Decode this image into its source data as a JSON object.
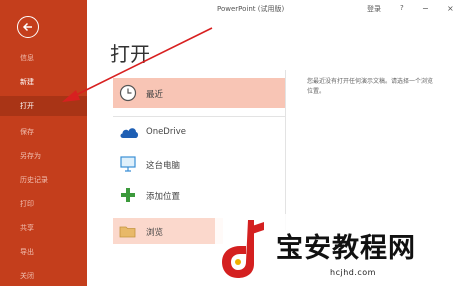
{
  "window": {
    "title": "PowerPoint (试用版)",
    "login": "登录",
    "help": "?",
    "minimize": "−",
    "close": "×"
  },
  "nav": {
    "items": [
      {
        "label": "信息"
      },
      {
        "label": "新建"
      },
      {
        "label": "打开"
      },
      {
        "label": "保存"
      },
      {
        "label": "另存为"
      },
      {
        "label": "历史记录"
      },
      {
        "label": "打印"
      },
      {
        "label": "共享"
      },
      {
        "label": "导出"
      },
      {
        "label": "关闭"
      }
    ]
  },
  "main": {
    "title": "打开",
    "places": [
      {
        "label": "最近",
        "icon": "clock-icon"
      },
      {
        "label": "OneDrive",
        "icon": "cloud-icon"
      },
      {
        "label": "这台电脑",
        "icon": "computer-icon"
      },
      {
        "label": "添加位置",
        "icon": "plus-icon"
      },
      {
        "label": "浏览",
        "icon": "folder-icon"
      }
    ],
    "recent_message_line1": "您最近没有打开任何演示文稿。请选择一个浏览",
    "recent_message_line2": "位置。"
  },
  "watermark": {
    "text": "宝安教程网",
    "url": "hcjhd.com"
  },
  "colors": {
    "nav_bg": "#c43e1c",
    "selected_bg": "#f8c5b5",
    "accent": "#c43e1c"
  }
}
